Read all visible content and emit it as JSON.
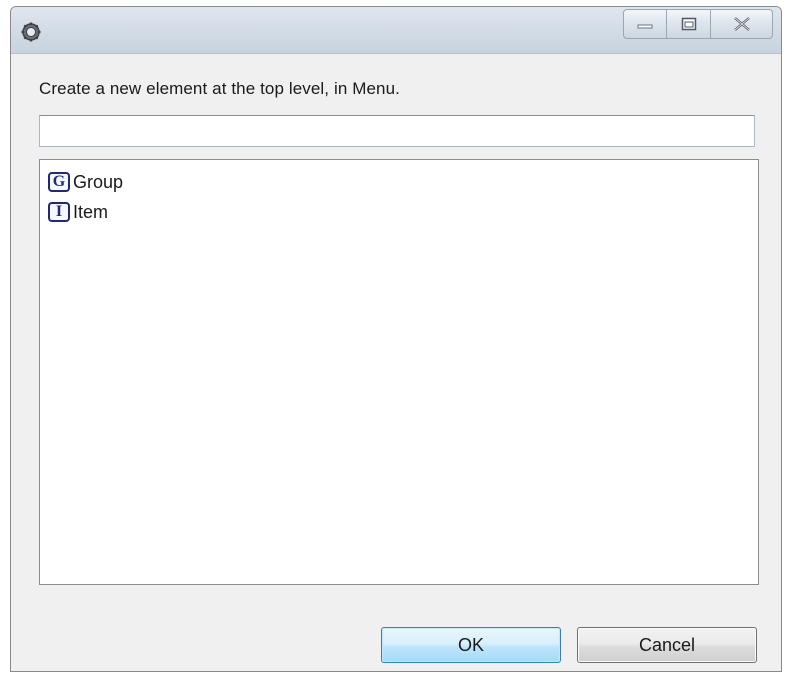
{
  "dialog": {
    "prompt": "Create a new element at the top level, in Menu.",
    "filter": {
      "value": "",
      "placeholder": ""
    },
    "items": [
      {
        "badge": "G",
        "label": "Group"
      },
      {
        "badge": "I",
        "label": "Item"
      }
    ],
    "buttons": {
      "ok_label": "OK",
      "cancel_label": "Cancel"
    }
  },
  "icons": {
    "app": "settings-gear-icon",
    "minimize": "minimize-icon",
    "maximize": "maximize-icon",
    "close": "close-icon"
  },
  "colors": {
    "badge": "#1e2a72",
    "ok_border": "#3c7fb1",
    "titlebar": "#d3dce6"
  }
}
